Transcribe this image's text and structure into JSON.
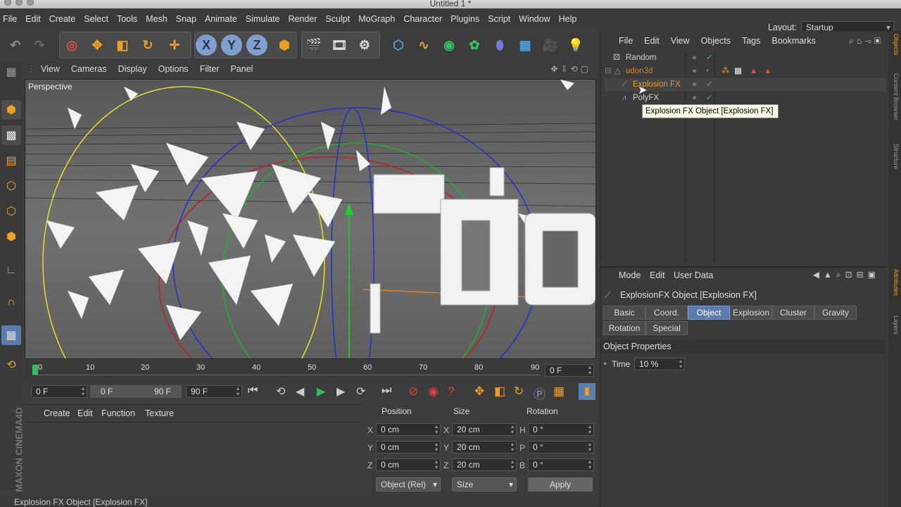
{
  "window": {
    "title": "Untitled 1 *"
  },
  "menu": [
    "File",
    "Edit",
    "Create",
    "Select",
    "Tools",
    "Mesh",
    "Snap",
    "Animate",
    "Simulate",
    "Render",
    "Sculpt",
    "MoGraph",
    "Character",
    "Plugins",
    "Script",
    "Window",
    "Help"
  ],
  "layout": {
    "label": "Layout:",
    "value": "Startup"
  },
  "viewport": {
    "menu": [
      "View",
      "Cameras",
      "Display",
      "Options",
      "Filter",
      "Panel"
    ],
    "label": "Perspective",
    "overlay_text": "Ud"
  },
  "timeline": {
    "ticks": [
      "0",
      "10",
      "20",
      "30",
      "40",
      "50",
      "60",
      "70",
      "80",
      "90"
    ],
    "frame_field": "0 F"
  },
  "transport": {
    "start": "0 F",
    "range_start": "0 F",
    "range_end": "90 F",
    "end": "90 F"
  },
  "material_panel": {
    "menu": [
      "Create",
      "Edit",
      "Function",
      "Texture"
    ]
  },
  "coord_panel": {
    "headers": [
      "Position",
      "Size",
      "Rotation"
    ],
    "rows": [
      {
        "axis": "X",
        "pos": "0 cm",
        "saxis": "X",
        "size": "20 cm",
        "raxis": "H",
        "rot": "0 °"
      },
      {
        "axis": "Y",
        "pos": "0 cm",
        "saxis": "Y",
        "size": "20 cm",
        "raxis": "P",
        "rot": "0 °"
      },
      {
        "axis": "Z",
        "pos": "0 cm",
        "saxis": "Z",
        "size": "20 cm",
        "raxis": "B",
        "rot": "0 °"
      }
    ],
    "mode_select": "Object (Rel)",
    "size_select": "Size",
    "apply": "Apply"
  },
  "status": "Explosion FX Object [Explosion FX]",
  "object_manager": {
    "menu": [
      "File",
      "Edit",
      "View",
      "Objects",
      "Tags",
      "Bookmarks"
    ],
    "objects": [
      {
        "name": "Random",
        "color": "#d0d0d0"
      },
      {
        "name": "udon3d",
        "color": "#d08a2a"
      },
      {
        "name": "Explosion FX",
        "color": "#e8a030"
      },
      {
        "name": "PolyFX",
        "color": "#d0d0d0"
      }
    ],
    "tooltip": "Explosion FX Object [Explosion FX]"
  },
  "attributes": {
    "menu": [
      "Mode",
      "Edit",
      "User Data"
    ],
    "title": "ExplosionFX Object [Explosion FX]",
    "tabs_row1": [
      "Basic",
      "Coord.",
      "Object",
      "Explosion",
      "Cluster",
      "Gravity"
    ],
    "tabs_row2": [
      "Rotation",
      "Special"
    ],
    "active_tab": "Object",
    "section": "Object Properties",
    "time_label": "Time",
    "time_value": "10 %"
  },
  "side_tabs": [
    "Objects",
    "Content Browser",
    "Structure",
    "Attributes",
    "Layers"
  ],
  "brand": "MAXON CINEMA4D"
}
